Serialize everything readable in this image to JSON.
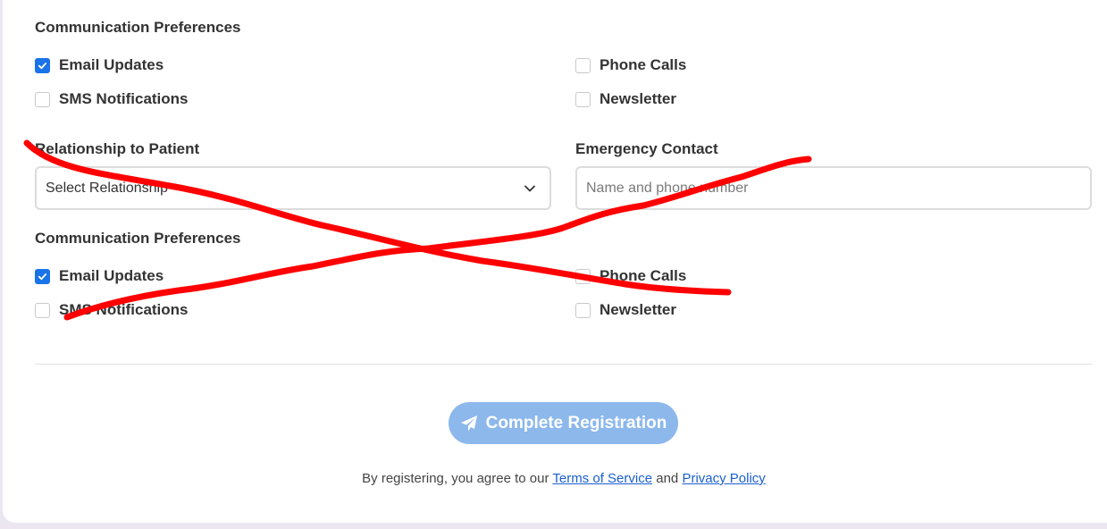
{
  "sections": [
    {
      "title": "Communication Preferences",
      "options": [
        {
          "label": "Email Updates",
          "checked": true
        },
        {
          "label": "Phone Calls",
          "checked": false
        },
        {
          "label": "SMS Notifications",
          "checked": false
        },
        {
          "label": "Newsletter",
          "checked": false
        }
      ]
    },
    {
      "title": "Communication Preferences",
      "options": [
        {
          "label": "Email Updates",
          "checked": true
        },
        {
          "label": "Phone Calls",
          "checked": false
        },
        {
          "label": "SMS Notifications",
          "checked": false
        },
        {
          "label": "Newsletter",
          "checked": false
        }
      ]
    }
  ],
  "relationship": {
    "label": "Relationship to Patient",
    "selected": "Select Relationship"
  },
  "emergency": {
    "label": "Emergency Contact",
    "placeholder": "Name and phone number",
    "value": ""
  },
  "submit": {
    "label": "Complete Registration",
    "icon": "paper-plane-icon"
  },
  "legal": {
    "prefix": "By registering, you agree to our",
    "terms": "Terms of Service",
    "and": "and",
    "privacy": "Privacy Policy"
  },
  "annotation": {
    "type": "red-cross-out",
    "color": "#ff0000"
  },
  "colors": {
    "checkbox_accent": "#1a73e8",
    "button": "#8cb8ec",
    "link": "#1a5fd0"
  }
}
